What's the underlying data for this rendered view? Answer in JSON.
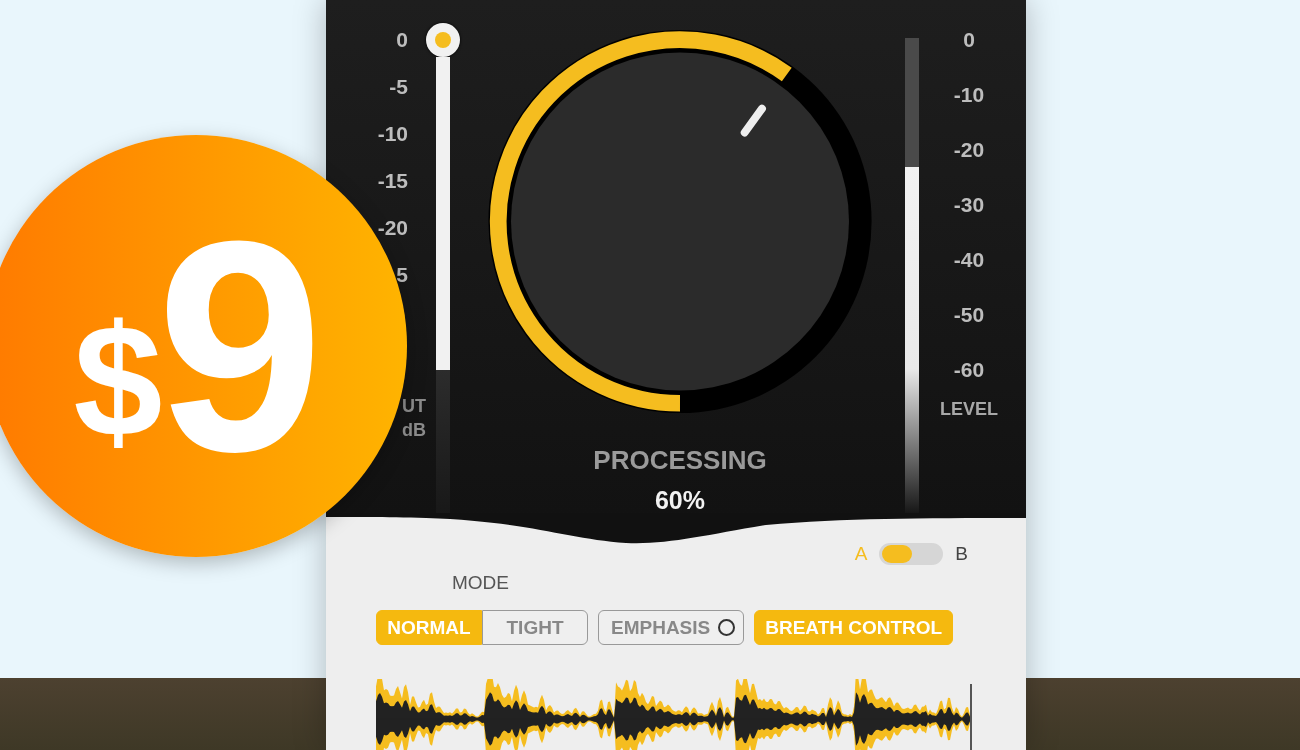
{
  "left_scale": {
    "ticks": [
      "0",
      "-5",
      "-10",
      "-15",
      "-20",
      "5"
    ],
    "label_lines": [
      "UT",
      "dB"
    ]
  },
  "knob": {
    "label": "PROCESSING",
    "value": "60%"
  },
  "level_meter": {
    "level": 0.73,
    "ticks": [
      "0",
      "-10",
      "-20",
      "-30",
      "-40",
      "-50",
      "-60"
    ],
    "label": "LEVEL"
  },
  "ab_switch": {
    "options": [
      {
        "label": "A",
        "selected": true
      },
      {
        "label": "B",
        "selected": false
      }
    ]
  },
  "mode": {
    "label": "MODE",
    "buttons": [
      {
        "label": "NORMAL",
        "selected": true,
        "kind": "segment"
      },
      {
        "label": "TIGHT",
        "selected": false,
        "kind": "segment"
      },
      {
        "label": "EMPHASIS",
        "selected": false,
        "kind": "toggle"
      },
      {
        "label": "BREATH CONTROL",
        "selected": true,
        "kind": "single"
      }
    ]
  },
  "price_badge": {
    "currency": "$",
    "amount": "9"
  }
}
